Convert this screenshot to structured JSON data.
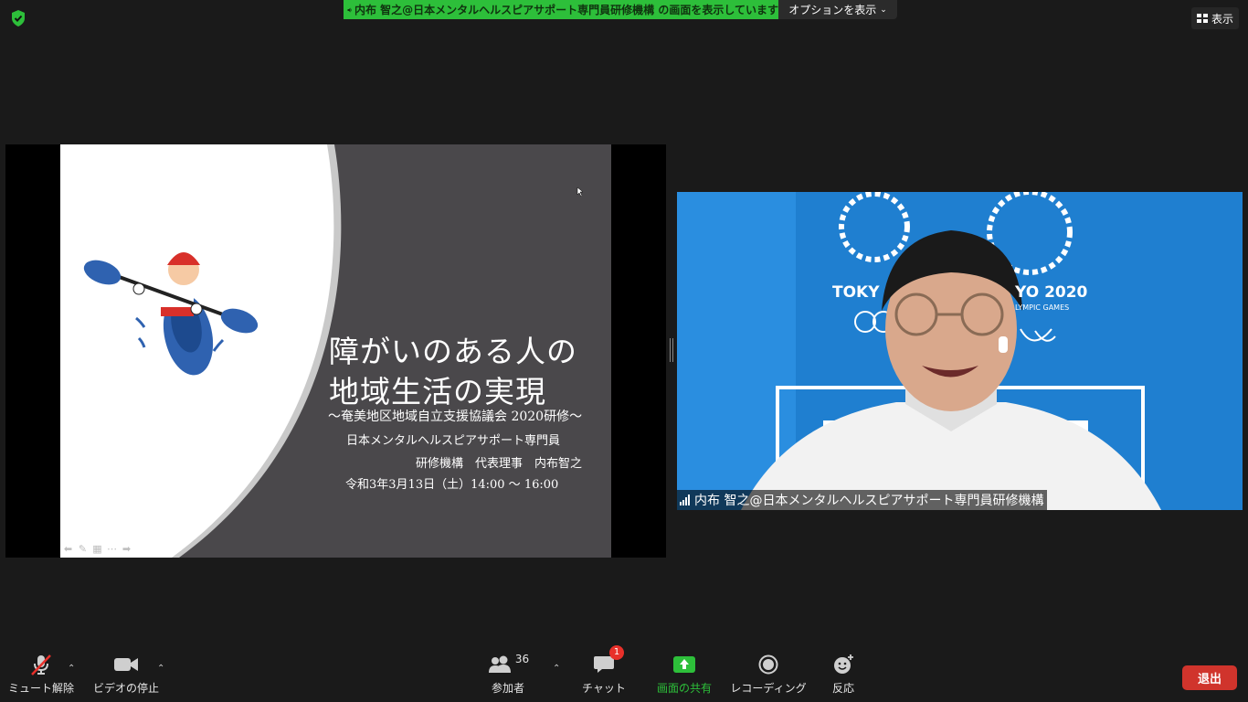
{
  "top": {
    "share_banner": "内布 智之@日本メンタルヘルスピアサポート専門員研修機構 の画面を表示しています",
    "options_label": "オプションを表示",
    "view_label": "表示"
  },
  "slide": {
    "title_line1": "障がいのある人の",
    "title_line2": "地域生活の実現",
    "subtitle": "～奄美地区地域自立支援協議会 2020研修～",
    "org_line1": "日本メンタルヘルスピアサポート専門員",
    "org_line2": "研修機構　代表理事　内布智之",
    "date": "令和3年3月13日（土）14:00 ～ 16:00"
  },
  "video": {
    "participant_name": "内布 智之@日本メンタルヘルスピアサポート専門員研修機構",
    "bg_text_left": "TOKY",
    "bg_text_right": "YO 2020",
    "bg_text_sub": "LYMPIC GAMES"
  },
  "toolbar": {
    "mute_label": "ミュート解除",
    "video_label": "ビデオの停止",
    "participants_label": "参加者",
    "participants_count": "36",
    "chat_label": "チャット",
    "chat_badge": "1",
    "share_label": "画面の共有",
    "record_label": "レコーディング",
    "reactions_label": "反応",
    "leave_label": "退出"
  },
  "colors": {
    "share_green": "#2dbf3a",
    "leave_red": "#d0342c",
    "toolbar_bg": "#1a1a1a"
  }
}
